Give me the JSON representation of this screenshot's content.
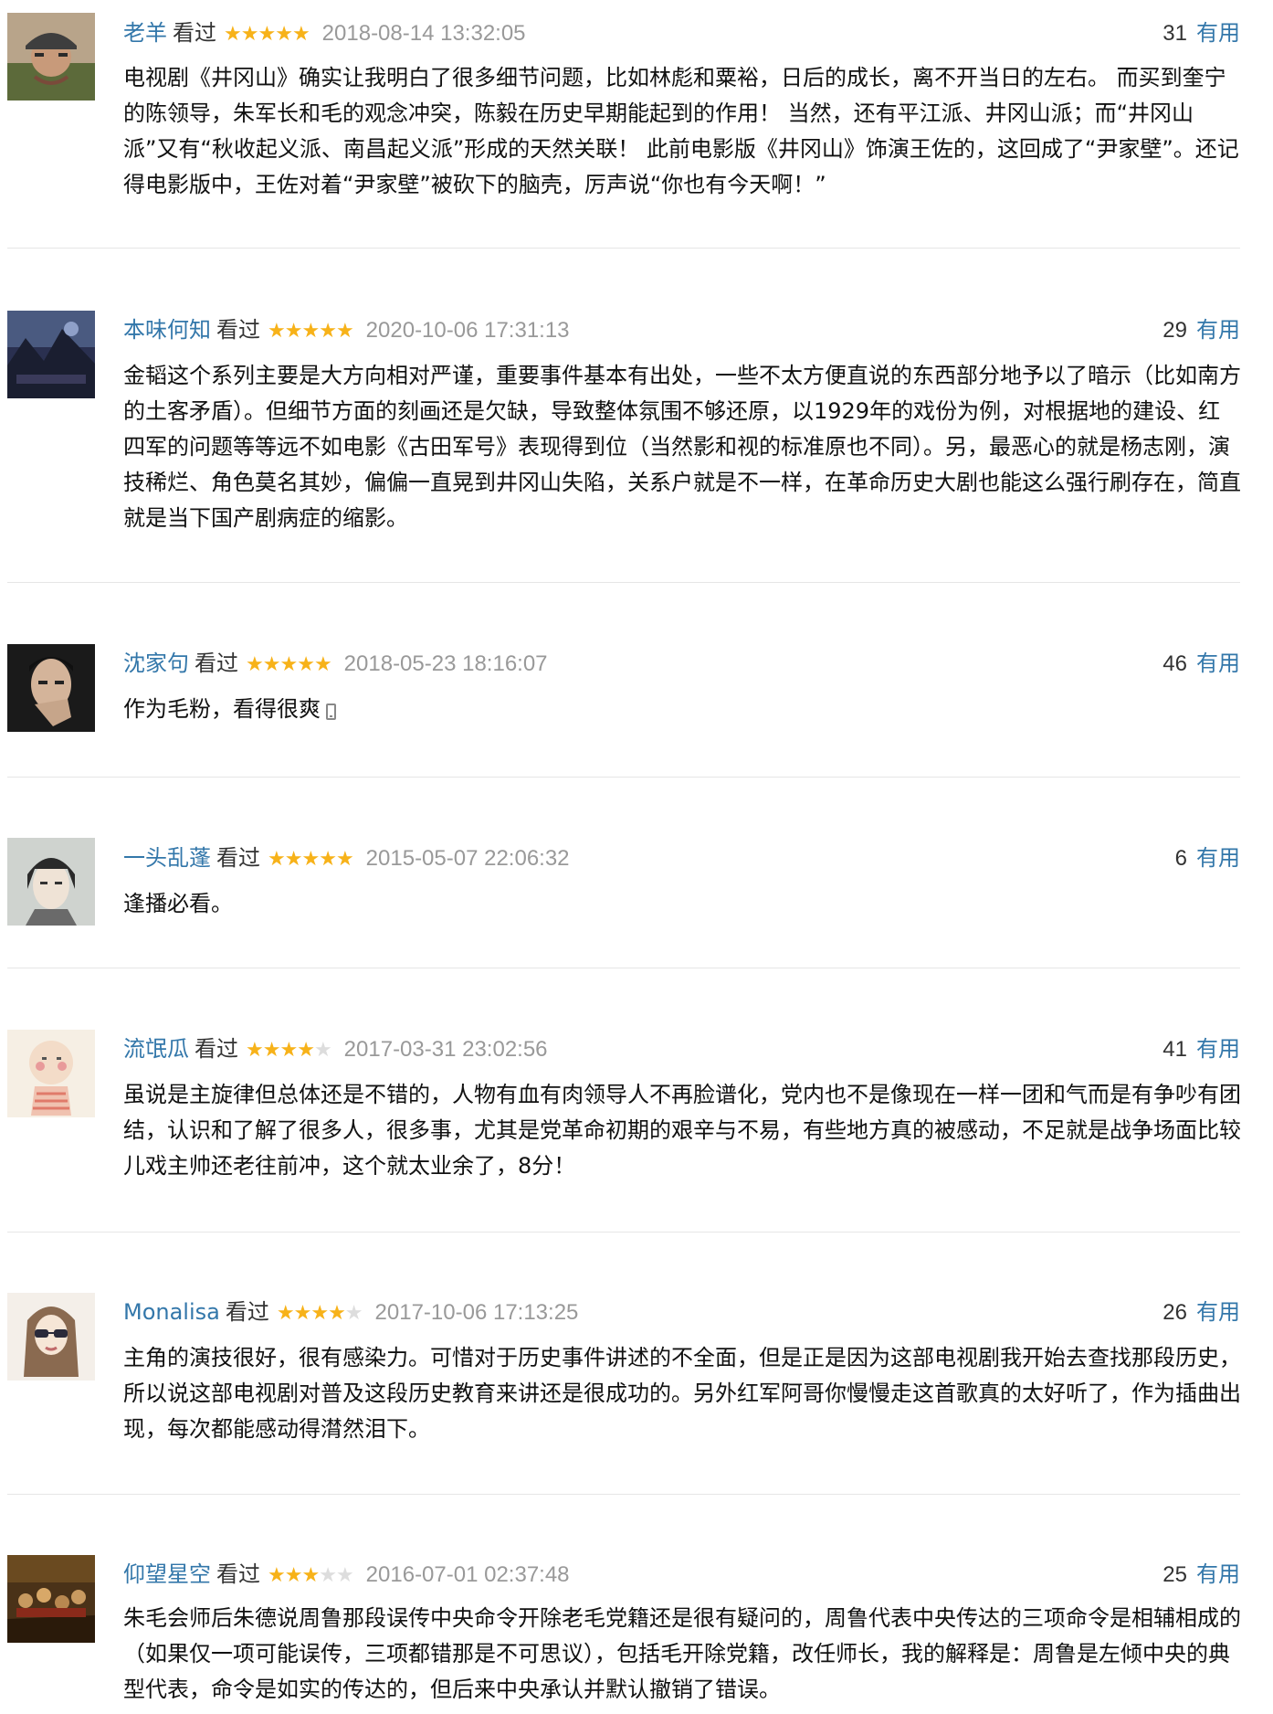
{
  "reviews": [
    {
      "user": "老羊",
      "status": "看过",
      "rating": 5,
      "time": "2018-08-14 13:32:05",
      "votes": "31",
      "useful": "有用",
      "avatar_icon": "man-in-cap-avatar",
      "content": "电视剧《井冈山》确实让我明白了很多细节问题，比如林彪和粟裕，日后的成长，离不开当日的左右。 而买到奎宁的陈领导，朱军长和毛的观念冲突，陈毅在历史早期能起到的作用！ 当然，还有平江派、井冈山派；而“井冈山派”又有“秋收起义派、南昌起义派”形成的天然关联！ 此前电影版《井冈山》饰演王佐的，这回成了“尹家壁”。还记得电影版中，王佐对着“尹家壁”被砍下的脑壳，厉声说“你也有今天啊！”"
    },
    {
      "user": "本味何知",
      "status": "看过",
      "rating": 5,
      "time": "2020-10-06 17:31:13",
      "votes": "29",
      "useful": "有用",
      "avatar_icon": "dark-landscape-avatar",
      "content": "金韬这个系列主要是大方向相对严谨，重要事件基本有出处，一些不太方便直说的东西部分地予以了暗示（比如南方的土客矛盾）。但细节方面的刻画还是欠缺，导致整体氛围不够还原，以1929年的戏份为例，对根据地的建设、红四军的问题等等远不如电影《古田军号》表现得到位（当然影和视的标准原也不同）。另，最恶心的就是杨志刚，演技稀烂、角色莫名其妙，偏偏一直晃到井冈山失陷，关系户就是不一样，在革命历史大剧也能这么强行刷存在，简直就是当下国产剧病症的缩影。"
    },
    {
      "user": "沈家句",
      "status": "看过",
      "rating": 5,
      "time": "2018-05-23 18:16:07",
      "votes": "46",
      "useful": "有用",
      "avatar_icon": "man-portrait-avatar",
      "content": "作为毛粉，看得很爽",
      "mobile_icon": "mobile-phone-icon"
    },
    {
      "user": "一头乱蓬",
      "status": "看过",
      "rating": 5,
      "time": "2015-05-07 22:06:32",
      "votes": "6",
      "useful": "有用",
      "avatar_icon": "anime-boy-avatar",
      "content": "逢播必看。"
    },
    {
      "user": "流氓瓜",
      "status": "看过",
      "rating": 4,
      "time": "2017-03-31 23:02:56",
      "votes": "41",
      "useful": "有用",
      "avatar_icon": "cartoon-baby-avatar",
      "content": "虽说是主旋律但总体还是不错的，人物有血有肉领导人不再脸谱化，党内也不是像现在一样一团和气而是有争吵有团结，认识和了解了很多人，很多事，尤其是党革命初期的艰辛与不易，有些地方真的被感动，不足就是战争场面比较儿戏主帅还老往前冲，这个就太业余了，8分！"
    },
    {
      "user": "Monalisa",
      "status": "看过",
      "rating": 4,
      "time": "2017-10-06 17:13:25",
      "votes": "26",
      "useful": "有用",
      "avatar_icon": "girl-sunglasses-avatar",
      "content": "主角的演技很好，很有感染力。可惜对于历史事件讲述的不全面，但是正是因为这部电视剧我开始去查找那段历史，所以说这部电视剧对普及这段历史教育来讲还是很成功的。另外红军阿哥你慢慢走这首歌真的太好听了，作为插曲出现，每次都能感动得潸然泪下。"
    },
    {
      "user": "仰望星空",
      "status": "看过",
      "rating": 3,
      "time": "2016-07-01 02:37:48",
      "votes": "25",
      "useful": "有用",
      "avatar_icon": "crowd-painting-avatar",
      "content": "朱毛会师后朱德说周鲁那段误传中央命令开除老毛党籍还是很有疑问的，周鲁代表中央传达的三项命令是相辅相成的（如果仅一项可能误传，三项都错那是不可思议），包括毛开除党籍，改任师长，我的解释是：周鲁是左倾中央的典型代表，命令是如实的传达的，但后来中央承认并默认撤销了错误。"
    }
  ]
}
